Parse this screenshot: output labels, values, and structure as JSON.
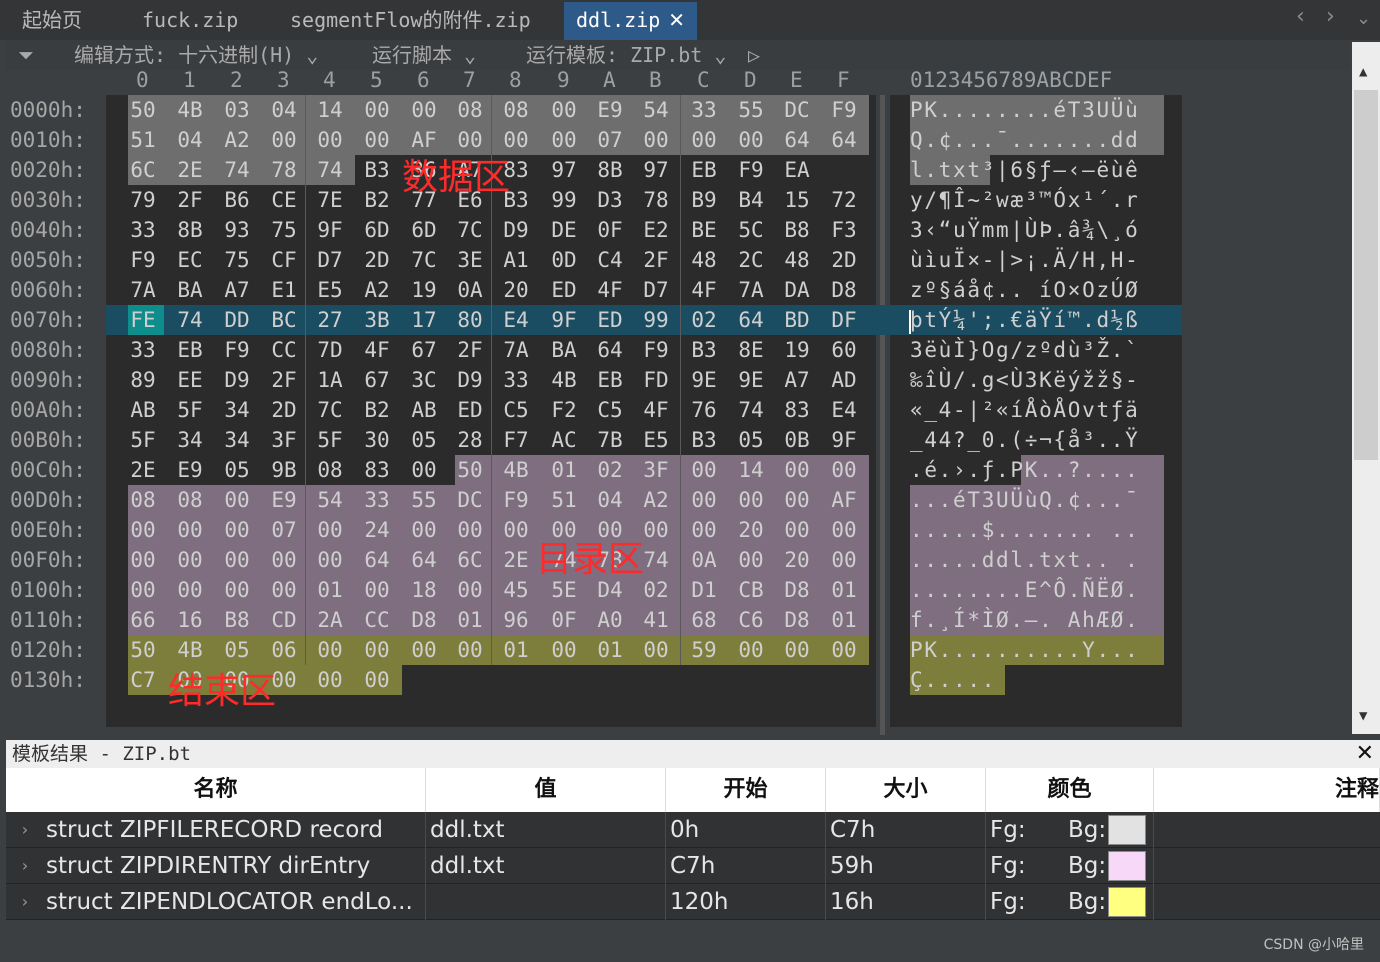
{
  "tabs": [
    {
      "label": "起始页"
    },
    {
      "label": "fuck.zip"
    },
    {
      "label": "segmentFlow的附件.zip"
    },
    {
      "label": "ddl.zip"
    }
  ],
  "active_tab_close": "✕",
  "toolbar": {
    "edit_mode": "编辑方式: 十六进制(H)",
    "run_script": "运行脚本",
    "run_template": "运行模板: ZIP.bt"
  },
  "hex_columns": [
    "0",
    "1",
    "2",
    "3",
    "4",
    "5",
    "6",
    "7",
    "8",
    "9",
    "A",
    "B",
    "C",
    "D",
    "E",
    "F"
  ],
  "ascii_header": "0123456789ABCDEF",
  "rows": [
    {
      "off": "0000h:",
      "bytes": [
        "50",
        "4B",
        "03",
        "04",
        "14",
        "00",
        "00",
        "08",
        "08",
        "00",
        "E9",
        "54",
        "33",
        "55",
        "DC",
        "F9"
      ],
      "ascii": "PK........éT3UÜù"
    },
    {
      "off": "0010h:",
      "bytes": [
        "51",
        "04",
        "A2",
        "00",
        "00",
        "00",
        "AF",
        "00",
        "00",
        "00",
        "07",
        "00",
        "00",
        "00",
        "64",
        "64"
      ],
      "ascii": "Q.¢...¯.......dd"
    },
    {
      "off": "0020h:",
      "bytes": [
        "6C",
        "2E",
        "74",
        "78",
        "74",
        "B3",
        "36",
        "A7",
        "83",
        "97",
        "8B",
        "97",
        "EB",
        "F9",
        "EA"
      ],
      "ascii": "l.txt³|6§ƒ—‹—ëùê"
    },
    {
      "off": "0030h:",
      "bytes": [
        "79",
        "2F",
        "B6",
        "CE",
        "7E",
        "B2",
        "77",
        "E6",
        "B3",
        "99",
        "D3",
        "78",
        "B9",
        "B4",
        "15",
        "72"
      ],
      "ascii": "y/¶Î~²wæ³™Óx¹´.r"
    },
    {
      "off": "0040h:",
      "bytes": [
        "33",
        "8B",
        "93",
        "75",
        "9F",
        "6D",
        "6D",
        "7C",
        "D9",
        "DE",
        "0F",
        "E2",
        "BE",
        "5C",
        "B8",
        "F3"
      ],
      "ascii": "3‹“uŸmm|ÙÞ.â¾\\¸ó"
    },
    {
      "off": "0050h:",
      "bytes": [
        "F9",
        "EC",
        "75",
        "CF",
        "D7",
        "2D",
        "7C",
        "3E",
        "A1",
        "0D",
        "C4",
        "2F",
        "48",
        "2C",
        "48",
        "2D"
      ],
      "ascii": "ùìuÏ×-|>¡.Ä/H,H-"
    },
    {
      "off": "0060h:",
      "bytes": [
        "7A",
        "BA",
        "A7",
        "E1",
        "E5",
        "A2",
        "19",
        "0A",
        "20",
        "ED",
        "4F",
        "D7",
        "4F",
        "7A",
        "DA",
        "D8"
      ],
      "ascii": "zº§áå¢.. íO×OzÚØ"
    },
    {
      "off": "0070h:",
      "bytes": [
        "FE",
        "74",
        "DD",
        "BC",
        "27",
        "3B",
        "17",
        "80",
        "E4",
        "9F",
        "ED",
        "99",
        "02",
        "64",
        "BD",
        "DF"
      ],
      "ascii": "þtÝ¼';.€äŸí™.d½ß"
    },
    {
      "off": "0080h:",
      "bytes": [
        "33",
        "EB",
        "F9",
        "CC",
        "7D",
        "4F",
        "67",
        "2F",
        "7A",
        "BA",
        "64",
        "F9",
        "B3",
        "8E",
        "19",
        "60"
      ],
      "ascii": "3ëùÌ}Og/zºdù³Ž.`"
    },
    {
      "off": "0090h:",
      "bytes": [
        "89",
        "EE",
        "D9",
        "2F",
        "1A",
        "67",
        "3C",
        "D9",
        "33",
        "4B",
        "EB",
        "FD",
        "9E",
        "9E",
        "A7",
        "AD"
      ],
      "ascii": "‰îÙ/.g<Ù3Këýžž§-"
    },
    {
      "off": "00A0h:",
      "bytes": [
        "AB",
        "5F",
        "34",
        "2D",
        "7C",
        "B2",
        "AB",
        "ED",
        "C5",
        "F2",
        "C5",
        "4F",
        "76",
        "74",
        "83",
        "E4"
      ],
      "ascii": "«_4-|²«íÅòÅOvtƒä"
    },
    {
      "off": "00B0h:",
      "bytes": [
        "5F",
        "34",
        "34",
        "3F",
        "5F",
        "30",
        "05",
        "28",
        "F7",
        "AC",
        "7B",
        "E5",
        "B3",
        "05",
        "0B",
        "9F"
      ],
      "ascii": "_44?_0.(÷¬{å³..Ÿ"
    },
    {
      "off": "00C0h:",
      "bytes": [
        "2E",
        "E9",
        "05",
        "9B",
        "08",
        "83",
        "00",
        "50",
        "4B",
        "01",
        "02",
        "3F",
        "00",
        "14",
        "00",
        "00"
      ],
      "ascii": ".é.›.ƒ.PK..?...."
    },
    {
      "off": "00D0h:",
      "bytes": [
        "08",
        "08",
        "00",
        "E9",
        "54",
        "33",
        "55",
        "DC",
        "F9",
        "51",
        "04",
        "A2",
        "00",
        "00",
        "00",
        "AF"
      ],
      "ascii": "...éT3UÜùQ.¢...¯"
    },
    {
      "off": "00E0h:",
      "bytes": [
        "00",
        "00",
        "00",
        "07",
        "00",
        "24",
        "00",
        "00",
        "00",
        "00",
        "00",
        "00",
        "00",
        "20",
        "00",
        "00"
      ],
      "ascii": ".....$....... .."
    },
    {
      "off": "00F0h:",
      "bytes": [
        "00",
        "00",
        "00",
        "00",
        "00",
        "64",
        "64",
        "6C",
        "2E",
        "74",
        "78",
        "74",
        "0A",
        "00",
        "20",
        "00"
      ],
      "ascii": ".....ddl.txt.. ."
    },
    {
      "off": "0100h:",
      "bytes": [
        "00",
        "00",
        "00",
        "00",
        "01",
        "00",
        "18",
        "00",
        "45",
        "5E",
        "D4",
        "02",
        "D1",
        "CB",
        "D8",
        "01"
      ],
      "ascii": "........E^Ô.ÑËØ."
    },
    {
      "off": "0110h:",
      "bytes": [
        "66",
        "16",
        "B8",
        "CD",
        "2A",
        "CC",
        "D8",
        "01",
        "96",
        "0F",
        "A0",
        "41",
        "68",
        "C6",
        "D8",
        "01"
      ],
      "ascii": "f.¸Í*ÌØ.–. AhÆØ."
    },
    {
      "off": "0120h:",
      "bytes": [
        "50",
        "4B",
        "05",
        "06",
        "00",
        "00",
        "00",
        "00",
        "01",
        "00",
        "01",
        "00",
        "59",
        "00",
        "00",
        "00"
      ],
      "ascii": "PK..........Y..."
    },
    {
      "off": "0130h:",
      "bytes": [
        "C7",
        "00",
        "00",
        "00",
        "00",
        "00"
      ],
      "ascii": "Ç....."
    }
  ],
  "annotations": {
    "data_area": "数据区",
    "dir_area": "目录区",
    "end_area": "结束区"
  },
  "panel": {
    "title": "模板结果 - ZIP.bt",
    "close": "✕",
    "columns": [
      "名称",
      "值",
      "开始",
      "大小",
      "颜色",
      "注释"
    ],
    "rows": [
      {
        "name": "struct ZIPFILERECORD record",
        "value": "ddl.txt",
        "start": "0h",
        "size": "C7h",
        "fg": "Fg:",
        "bg": "Bg:",
        "bg_color": "#e2e2e2"
      },
      {
        "name": "struct ZIPDIRENTRY dirEntry",
        "value": "ddl.txt",
        "start": "C7h",
        "size": "59h",
        "fg": "Fg:",
        "bg": "Bg:",
        "bg_color": "#f8d8f8"
      },
      {
        "name": "struct ZIPENDLOCATOR endLo...",
        "value": "",
        "start": "120h",
        "size": "16h",
        "fg": "Fg:",
        "bg": "Bg:",
        "bg_color": "#ffff80"
      }
    ]
  },
  "colors": {
    "record_bg": "#6e6e6e",
    "dir_bg": "#7e6e80",
    "end_bg": "#7e7e3c",
    "cursor_row": "#1b4d62",
    "cursor_byte": "#0f8c8c"
  },
  "footer": "CSDN @小哈里"
}
